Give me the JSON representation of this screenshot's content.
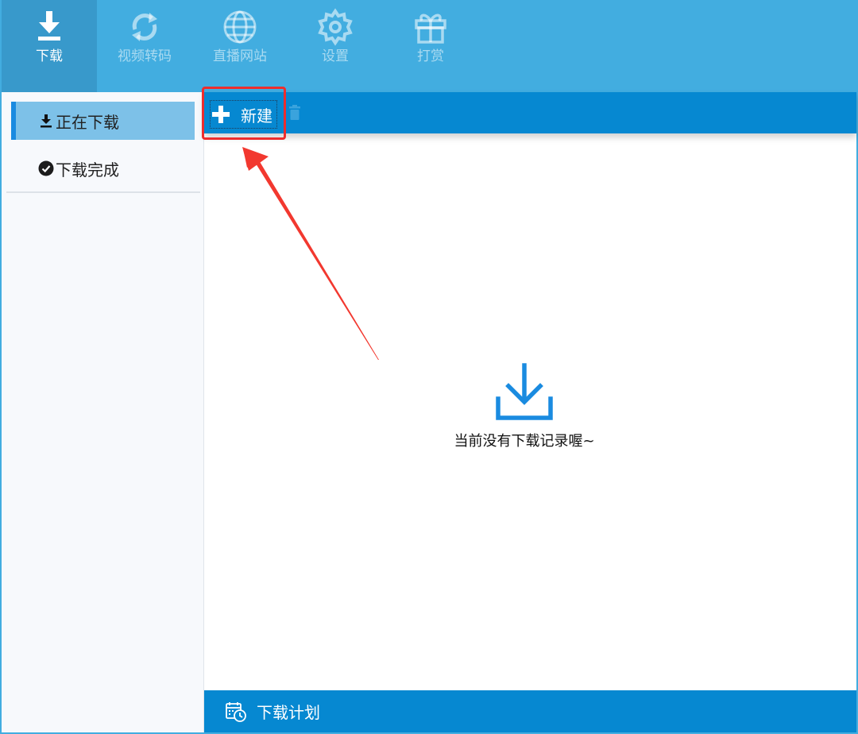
{
  "nav": {
    "items": [
      {
        "label": "下载",
        "icon": "download-icon",
        "active": true
      },
      {
        "label": "视频转码",
        "icon": "refresh-icon",
        "active": false
      },
      {
        "label": "直播网站",
        "icon": "globe-icon",
        "active": false
      },
      {
        "label": "设置",
        "icon": "gear-icon",
        "active": false
      },
      {
        "label": "打赏",
        "icon": "gift-icon",
        "active": false
      }
    ]
  },
  "sidebar": {
    "items": [
      {
        "label": "正在下载",
        "icon": "download-small-icon",
        "active": true
      },
      {
        "label": "下载完成",
        "icon": "check-circle-icon",
        "active": false
      }
    ]
  },
  "toolbar": {
    "new_label": "新建",
    "new_icon": "plus-icon",
    "delete_icon": "trash-icon"
  },
  "main": {
    "empty_icon": "download-tray-icon",
    "empty_text": "当前没有下载记录喔~"
  },
  "bottom": {
    "schedule_label": "下载计划",
    "schedule_icon": "calendar-clock-icon"
  },
  "colors": {
    "topbar": "#42ade0",
    "topbar_active": "#3899cb",
    "toolbar": "#0688d1",
    "sidebar_active": "#7dc1e8",
    "accent": "#1a8be0",
    "highlight": "#ee2d2d"
  }
}
